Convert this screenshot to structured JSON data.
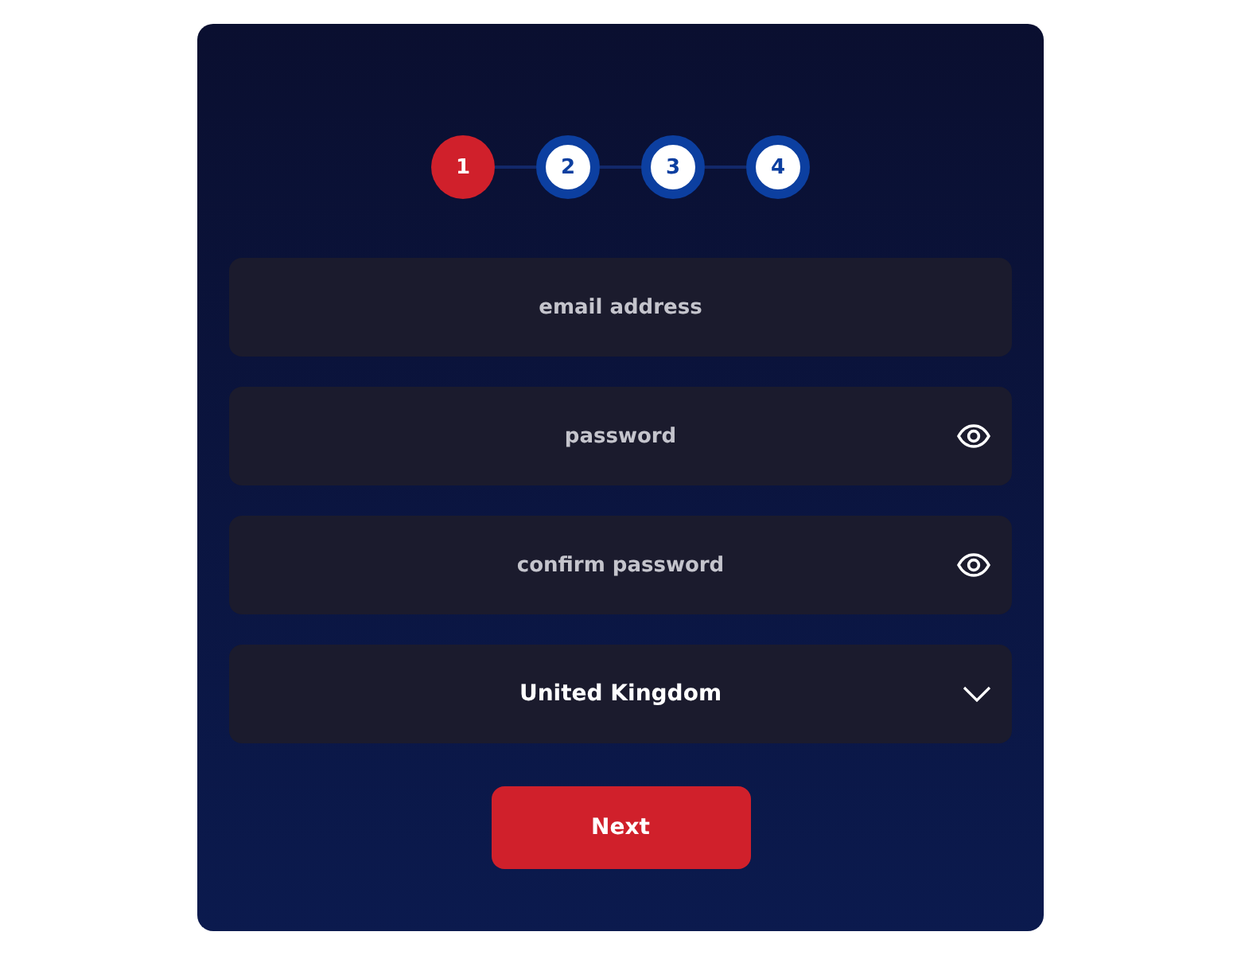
{
  "steps": [
    {
      "label": "1",
      "selected": true
    },
    {
      "label": "2",
      "selected": false
    },
    {
      "label": "3",
      "selected": false
    },
    {
      "label": "4",
      "selected": false
    }
  ],
  "fields": [
    {
      "kind": "text",
      "placeholder": "email address"
    },
    {
      "kind": "password",
      "placeholder": "password"
    },
    {
      "kind": "password",
      "placeholder": "confirm password"
    },
    {
      "kind": "select",
      "value": "United Kingdom"
    }
  ],
  "button": "Next"
}
